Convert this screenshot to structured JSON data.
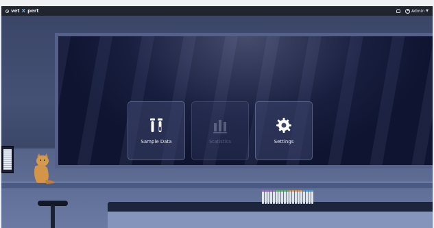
{
  "app": {
    "logo_prefix": "vet",
    "logo_x": "X",
    "logo_suffix": "pert"
  },
  "topbar": {
    "user_label": "Admin"
  },
  "tiles": [
    {
      "label": "Sample Data",
      "icon": "test-tubes-icon",
      "enabled": true
    },
    {
      "label": "Statistics",
      "icon": "bar-chart-icon",
      "enabled": false
    },
    {
      "label": "Settings",
      "icon": "gear-icon",
      "enabled": true
    }
  ],
  "colors": {
    "accent": "#7fb1ff",
    "topbar": "#20242e"
  }
}
